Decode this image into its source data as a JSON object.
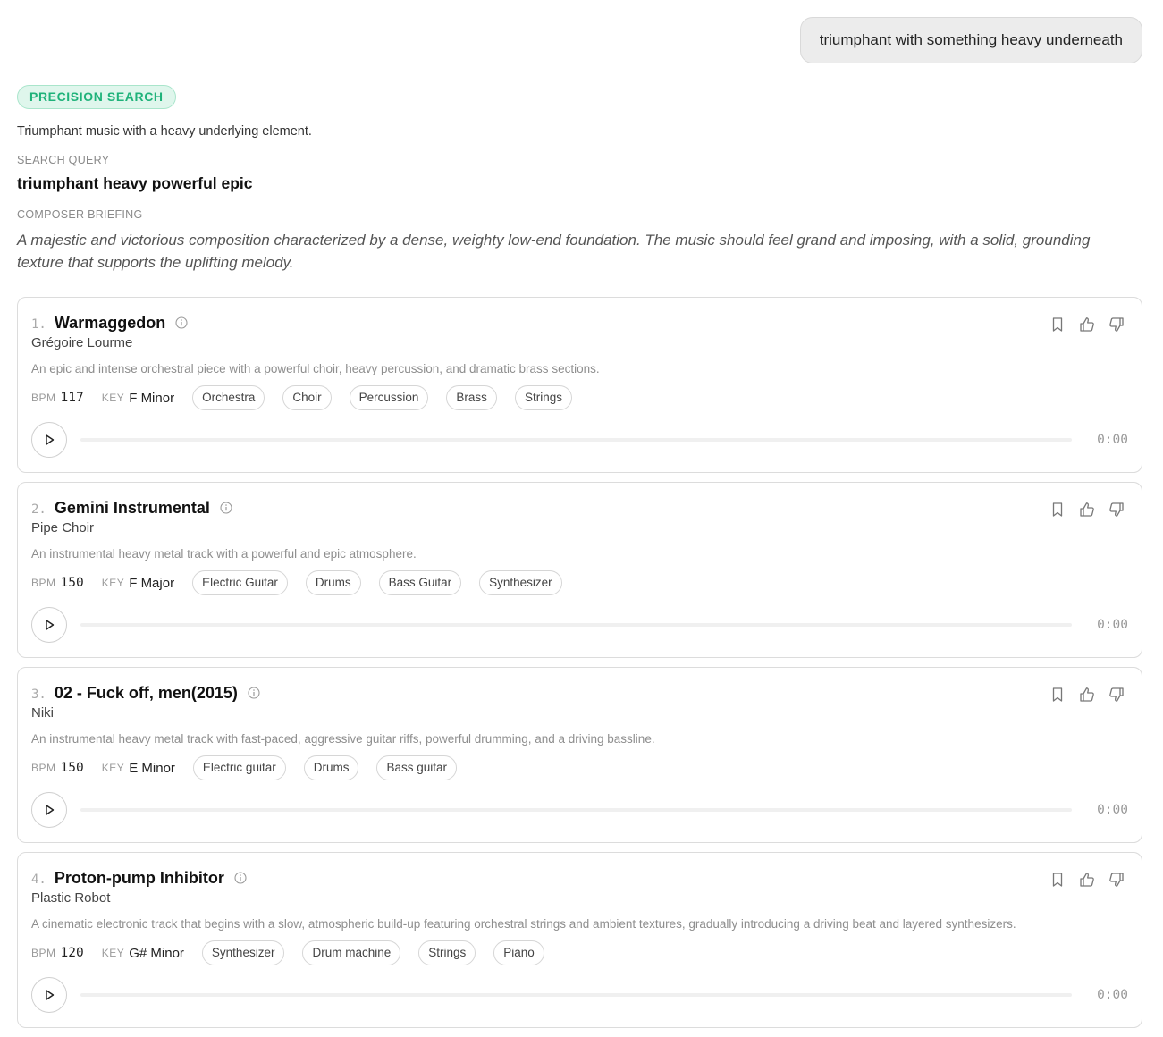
{
  "user_message": "triumphant with something heavy underneath",
  "response": {
    "mode_badge": "PRECISION SEARCH",
    "summary": "Triumphant music with a heavy underlying element.",
    "search_query_label": "SEARCH QUERY",
    "search_query": "triumphant heavy powerful epic",
    "briefing_label": "COMPOSER BRIEFING",
    "briefing": "A majestic and victorious composition characterized by a dense, weighty low-end foundation. The music should feel grand and imposing, with a solid, grounding texture that supports the uplifting melody."
  },
  "labels": {
    "bpm": "BPM",
    "key": "KEY"
  },
  "icons": {
    "info": "info-circle-icon",
    "bookmark": "bookmark-icon",
    "thumbs_up": "thumbs-up-icon",
    "thumbs_down": "thumbs-down-icon",
    "play": "play-icon"
  },
  "colors": {
    "badge_text": "#1fb27a",
    "badge_bg": "#dff6ec"
  },
  "tracks": [
    {
      "number": "1.",
      "title": "Warmaggedon",
      "artist": "Grégoire Lourme",
      "description": "An epic and intense orchestral piece with a powerful choir, heavy percussion, and dramatic brass sections.",
      "bpm": "117",
      "key": "F Minor",
      "tags": [
        "Orchestra",
        "Choir",
        "Percussion",
        "Brass",
        "Strings"
      ],
      "time": "0:00",
      "progress": 0
    },
    {
      "number": "2.",
      "title": "Gemini Instrumental",
      "artist": "Pipe Choir",
      "description": "An instrumental heavy metal track with a powerful and epic atmosphere.",
      "bpm": "150",
      "key": "F Major",
      "tags": [
        "Electric Guitar",
        "Drums",
        "Bass Guitar",
        "Synthesizer"
      ],
      "time": "0:00",
      "progress": 0
    },
    {
      "number": "3.",
      "title": "02 - Fuck off, men(2015)",
      "artist": "Niki",
      "description": "An instrumental heavy metal track with fast-paced, aggressive guitar riffs, powerful drumming, and a driving bassline.",
      "bpm": "150",
      "key": "E Minor",
      "tags": [
        "Electric guitar",
        "Drums",
        "Bass guitar"
      ],
      "time": "0:00",
      "progress": 0
    },
    {
      "number": "4.",
      "title": "Proton-pump Inhibitor",
      "artist": "Plastic Robot",
      "description": "A cinematic electronic track that begins with a slow, atmospheric build-up featuring orchestral strings and ambient textures, gradually introducing a driving beat and layered synthesizers.",
      "bpm": "120",
      "key": "G# Minor",
      "tags": [
        "Synthesizer",
        "Drum machine",
        "Strings",
        "Piano"
      ],
      "time": "0:00",
      "progress": 0
    }
  ]
}
